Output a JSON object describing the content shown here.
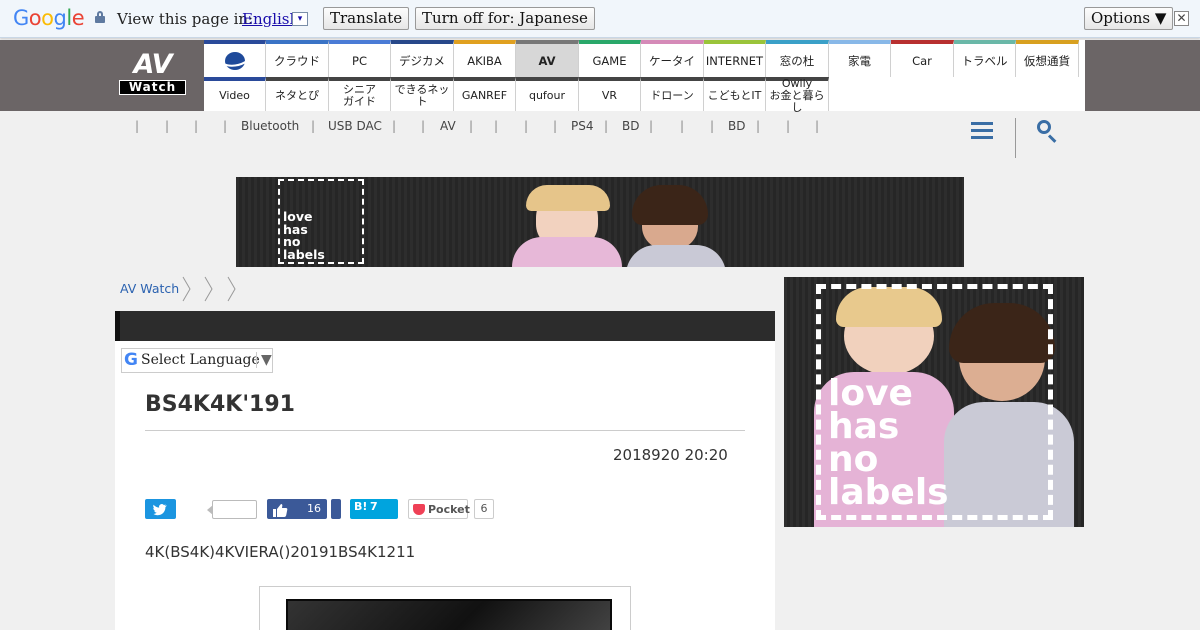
{
  "translate_bar": {
    "logo_letters": [
      "G",
      "o",
      "o",
      "g",
      "l",
      "e"
    ],
    "prompt": "View this page in:",
    "language": "English",
    "language_arrow": "▾",
    "translate_button": "Translate",
    "turn_off_button": "Turn off for: Japanese",
    "options_button": "Options ▼",
    "close_glyph": "✕"
  },
  "site": {
    "logo_top": "AV",
    "logo_bottom": "Watch"
  },
  "nav_top": [
    {
      "label": "",
      "color": "#2a4a9a"
    },
    {
      "label": "クラウド",
      "color": "#3a73c6"
    },
    {
      "label": "PC",
      "color": "#4a7bd6"
    },
    {
      "label": "デジカメ",
      "color": "#27488a"
    },
    {
      "label": "AKIBA",
      "color": "#e0a020"
    },
    {
      "label": "AV",
      "color": "#777777"
    },
    {
      "label": "GAME",
      "color": "#2aa86a"
    },
    {
      "label": "ケータイ",
      "color": "#d58ab8"
    },
    {
      "label": "INTERNET",
      "color": "#9ac43a"
    },
    {
      "label": "窓の杜",
      "color": "#3aa0c8"
    },
    {
      "label": "家電",
      "color": "#88b8e8"
    },
    {
      "label": "Car",
      "color": "#b83030"
    },
    {
      "label": "トラベル",
      "color": "#6ab8a8"
    },
    {
      "label": "仮想通貨",
      "color": "#d8a020"
    }
  ],
  "nav_bottom": [
    {
      "label": "Video"
    },
    {
      "label": "ネタとぴ"
    },
    {
      "label": "シニア\nガイド"
    },
    {
      "label": "できるネット"
    },
    {
      "label": "GANREF"
    },
    {
      "label": "qufour"
    },
    {
      "label": "VR"
    },
    {
      "label": "ドローン"
    },
    {
      "label": "こどもとIT"
    },
    {
      "label": "Owlly\nお金と暮らし"
    }
  ],
  "submenu": [
    "|",
    "|",
    "|",
    "|",
    "Bluetooth",
    "|",
    "USB DAC",
    "|",
    "|",
    "AV",
    "|",
    "|",
    "|",
    "|",
    "PS4",
    "|",
    "BD",
    "|",
    "|",
    "|",
    "BD",
    "|",
    "|",
    "|"
  ],
  "ad": {
    "text_lines": [
      "love",
      "has",
      "no",
      "labels"
    ]
  },
  "breadcrumb": {
    "home": "AV Watch"
  },
  "article": {
    "translate_widget": "Select Language",
    "translate_arrow": "▼",
    "translate_logo": "G",
    "title": "BS4K4K'191",
    "date": "2018920 20:20",
    "lead": "4K(BS4K)4KVIERA()20191BS4K1211"
  },
  "share": {
    "twitter_count": "",
    "facebook_count": "16",
    "hatena_label": "B!",
    "hatena_count": "7",
    "pocket_label": "Pocket",
    "pocket_count": "6"
  },
  "colors": {
    "link": "#2b62b0",
    "twitter": "#1b95e0",
    "facebook": "#3b5998",
    "hatena": "#00a4de",
    "pocket": "#ef4056"
  }
}
